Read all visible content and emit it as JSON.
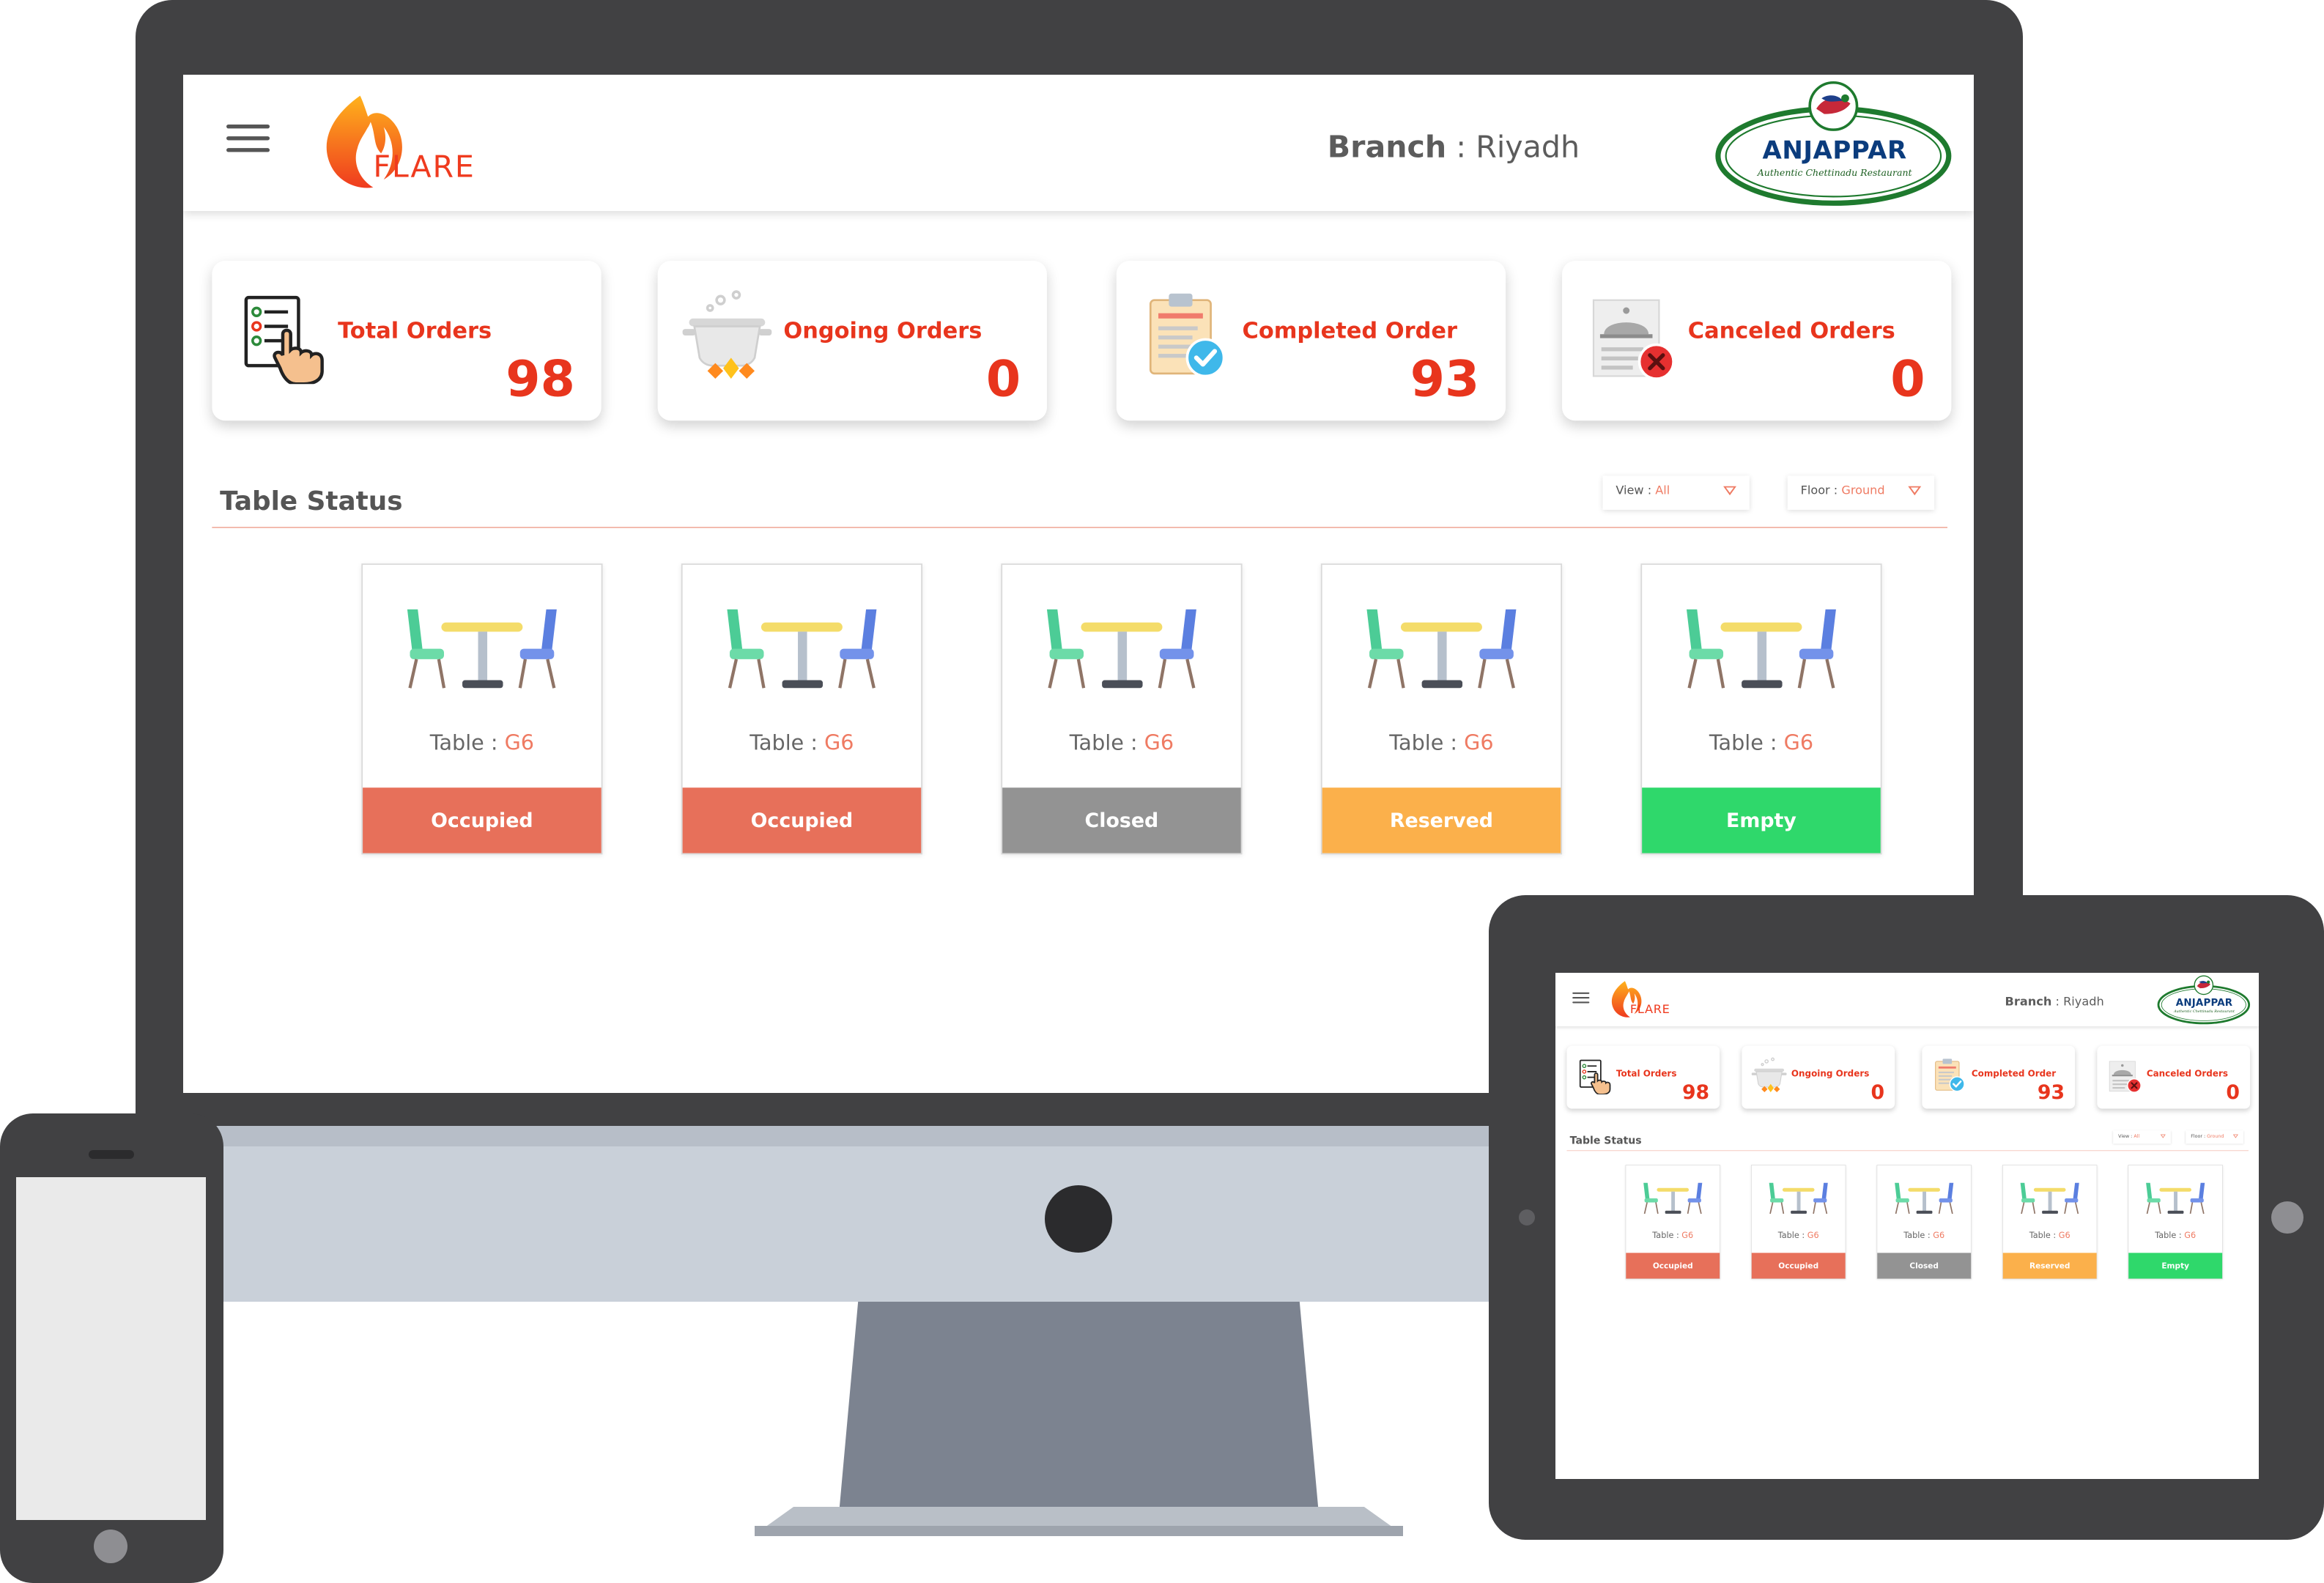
{
  "header": {
    "app_name": "FLARE",
    "branch_label": "Branch",
    "branch_separator": " : ",
    "branch_value": "Riyadh",
    "restaurant_logo_text": "ANJAPPAR",
    "restaurant_logo_tagline": "Authentic Chettinadu Restaurant"
  },
  "stats": [
    {
      "label": "Total Orders",
      "value": "98",
      "icon": "order-list-icon"
    },
    {
      "label": "Ongoing Orders",
      "value": "0",
      "icon": "cooking-pot-icon"
    },
    {
      "label": "Completed Order",
      "value": "93",
      "icon": "clipboard-check-icon"
    },
    {
      "label": "Canceled Orders",
      "value": "0",
      "icon": "cloche-cancel-icon"
    }
  ],
  "table_status": {
    "title": "Table Status",
    "filters": [
      {
        "label": "View",
        "separator": " : ",
        "value": "All"
      },
      {
        "label": "Floor",
        "separator": " : ",
        "value": "Ground"
      }
    ],
    "table_prefix": "Table",
    "table_separator": " : ",
    "tables": [
      {
        "id": "G6",
        "status": "Occupied"
      },
      {
        "id": "G6",
        "status": "Occupied"
      },
      {
        "id": "G6",
        "status": "Closed"
      },
      {
        "id": "G6",
        "status": "Reserved"
      },
      {
        "id": "G6",
        "status": "Empty"
      }
    ]
  },
  "colors": {
    "accent": "#e8351d",
    "occupied": "#e7705a",
    "closed": "#939393",
    "reserved": "#fbb04b",
    "empty": "#2fd86b"
  }
}
